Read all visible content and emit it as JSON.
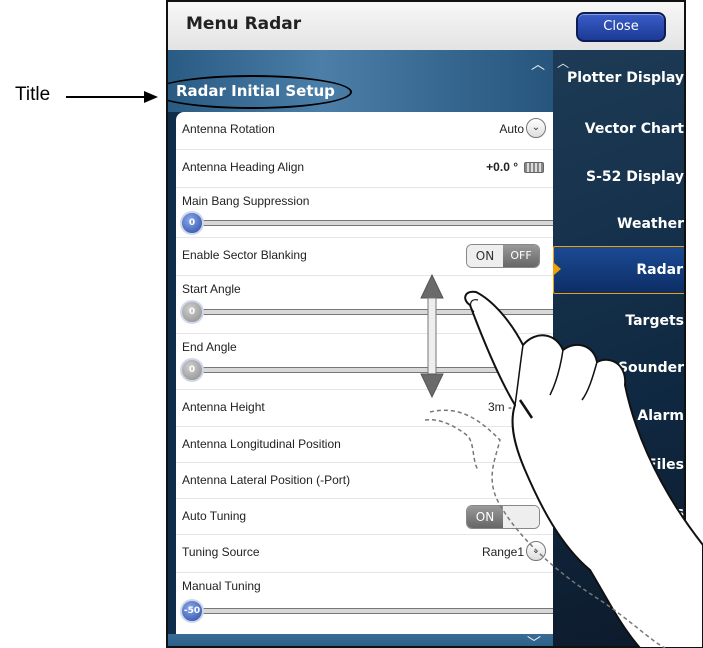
{
  "annotation": {
    "label": "Title"
  },
  "header": {
    "title": "Menu Radar",
    "close_label": "Close"
  },
  "section": {
    "title": "Radar Initial Setup"
  },
  "settings": [
    {
      "label": "Antenna Rotation",
      "value": "Auto",
      "control": "dropdown"
    },
    {
      "label": "Antenna Heading Align",
      "value": "+0.0 °",
      "control": "keyboard"
    },
    {
      "label": "Main Bang Suppression",
      "value": "0",
      "control": "slider"
    },
    {
      "label": "Enable Sector Blanking",
      "on_label": "ON",
      "off_label": "OFF",
      "selected": "OFF",
      "control": "toggle"
    },
    {
      "label": "Start Angle",
      "value": "0",
      "control": "slider"
    },
    {
      "label": "End Angle",
      "value": "0",
      "control": "slider"
    },
    {
      "label": "Antenna Height",
      "value": "3m -",
      "control": "dropdown"
    },
    {
      "label": "Antenna Longitudinal Position",
      "value": "",
      "control": "none"
    },
    {
      "label": "Antenna Lateral Position (-Port)",
      "value": "",
      "control": "none"
    },
    {
      "label": "Auto Tuning",
      "on_label": "ON",
      "off_label": "",
      "selected": "ON",
      "control": "toggle"
    },
    {
      "label": "Tuning Source",
      "value": "Range1",
      "control": "dropdown"
    },
    {
      "label": "Manual Tuning",
      "value": "-50",
      "control": "slider"
    }
  ],
  "sidebar": {
    "items": [
      {
        "label": "Plotter Display"
      },
      {
        "label": "Vector Chart"
      },
      {
        "label": "S-52 Display"
      },
      {
        "label": "Weather"
      },
      {
        "label": "Radar",
        "active": true
      },
      {
        "label": "Targets"
      },
      {
        "label": "Sounder"
      },
      {
        "label": "Alarm"
      },
      {
        "label": "Files"
      },
      {
        "label": "s"
      }
    ]
  },
  "colors": {
    "accent": "#1c3a96",
    "active_border": "#f0a000",
    "knob": "#2749a8"
  }
}
